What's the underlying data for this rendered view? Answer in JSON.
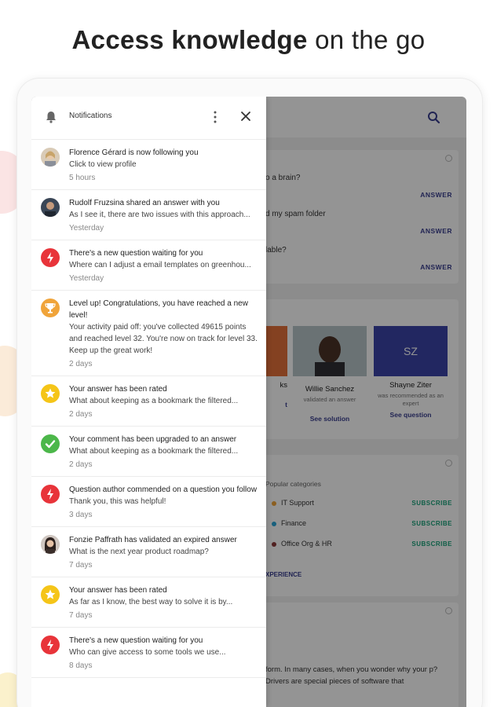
{
  "headline": {
    "bold": "Access knowledge",
    "rest": " on the go"
  },
  "colors": {
    "accent": "#3a3f8f",
    "red": "#e8343a",
    "orange": "#f0a43a",
    "yellow": "#f5c518",
    "green": "#4cb74a",
    "subscribe": "#1aa37a"
  },
  "background_app": {
    "questions": [
      {
        "text": "o a brain?",
        "action": "ANSWER"
      },
      {
        "text": "d my spam folder",
        "action": "ANSWER"
      },
      {
        "text": "lable?",
        "action": "ANSWER"
      }
    ],
    "people": [
      {
        "name": "ks",
        "subtitle": "",
        "action": "t"
      },
      {
        "name": "Willie Sanchez",
        "subtitle": "validated an answer",
        "action": "See solution"
      },
      {
        "initials": "SZ",
        "name": "Shayne Ziter",
        "subtitle": "was recommended as an expert",
        "action": "See question"
      }
    ],
    "categories_label": "Popular categories",
    "categories": [
      {
        "name": "IT Support",
        "action": "SUBSCRIBE"
      },
      {
        "name": "Finance",
        "action": "SUBSCRIBE"
      },
      {
        "name": "Office Org & HR",
        "action": "SUBSCRIBE"
      }
    ],
    "experience_link": "XPERIENCE",
    "article_text": "form. In many cases, when you wonder why your p? Drivers are special pieces of software that"
  },
  "drawer": {
    "title": "Notifications",
    "items": [
      {
        "icon": "avatar-florence",
        "title": "Florence Gérard is now following you",
        "body": "Click to view profile",
        "time": "5 hours"
      },
      {
        "icon": "avatar-rudolf",
        "title": "Rudolf Fruzsina shared an answer with you",
        "body": "As I see it, there are two issues with this approach...",
        "time": "Yesterday"
      },
      {
        "icon": "lightning-icon",
        "title": "There's a new question waiting for you",
        "body": "Where can I adjust a email templates on greenhou...",
        "time": "Yesterday"
      },
      {
        "icon": "trophy-icon",
        "title": "Level up! Congratulations, you have reached a new level!",
        "body": "Your activity paid off: you've collected 49615 points and reached level 32. You're now on track for level 33. Keep up the great work!",
        "time": "2 days"
      },
      {
        "icon": "star-icon",
        "title": "Your answer has been rated",
        "body": "What about keeping as a bookmark the filtered...",
        "time": "2 days"
      },
      {
        "icon": "check-icon",
        "title": "Your comment has been upgraded to an answer",
        "body": "What about keeping as a bookmark the filtered...",
        "time": "2 days"
      },
      {
        "icon": "lightning-icon",
        "title": "Question author commended on a question you follow",
        "body": "Thank you, this was helpful!",
        "time": "3 days"
      },
      {
        "icon": "avatar-fonzie",
        "title": "Fonzie Paffrath has validated an expired answer",
        "body": "What is the next year product roadmap?",
        "time": "7 days"
      },
      {
        "icon": "star-icon",
        "title": "Your answer has been rated",
        "body": "As far as I know, the best way to solve it is by...",
        "time": "7 days"
      },
      {
        "icon": "lightning-icon",
        "title": "There's a new question waiting for you",
        "body": "Who can give access to some tools we use...",
        "time": "8 days"
      }
    ]
  }
}
